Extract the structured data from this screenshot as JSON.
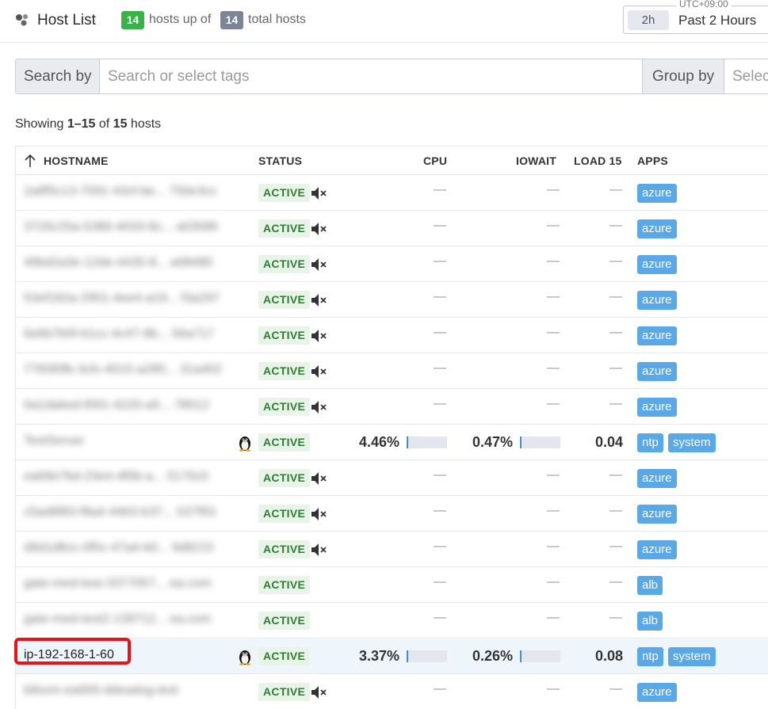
{
  "header": {
    "title": "Host List",
    "hosts_up": "14",
    "hosts_up_text": "hosts up of",
    "hosts_total": "14",
    "hosts_total_text": "total hosts",
    "timezone": "UTC+09:00",
    "time_chip": "2h",
    "time_label": "Past 2 Hours"
  },
  "search": {
    "label": "Search by",
    "placeholder": "Search or select tags",
    "group_label": "Group by",
    "group_placeholder": "Select"
  },
  "summary": {
    "prefix": "Showing",
    "range": "1–15",
    "of": "of",
    "count": "15",
    "suffix": "hosts"
  },
  "table": {
    "columns": {
      "hostname": "HOSTNAME",
      "status": "STATUS",
      "cpu": "CPU",
      "iowait": "IOWAIT",
      "load15": "LOAD 15",
      "apps": "APPS"
    },
    "rows": [
      {
        "hostname": "2a8f5c13-7591-43cf-be... 750e3cc",
        "blurred": true,
        "os": "",
        "status": "ACTIVE",
        "muted": true,
        "cpu": "—",
        "cpu_pct": null,
        "iowait": "—",
        "iowait_pct": null,
        "load15": "—",
        "apps": [
          "azure"
        ],
        "highlighted": false
      },
      {
        "hostname": "3726c25a-5380-4033-8c... a03585",
        "blurred": true,
        "os": "",
        "status": "ACTIVE",
        "muted": true,
        "cpu": "—",
        "cpu_pct": null,
        "iowait": "—",
        "iowait_pct": null,
        "load15": "—",
        "apps": [
          "azure"
        ],
        "highlighted": false
      },
      {
        "hostname": "49bd2a3e-12de-4435-8... a08480",
        "blurred": true,
        "os": "",
        "status": "ACTIVE",
        "muted": true,
        "cpu": "—",
        "cpu_pct": null,
        "iowait": "—",
        "iowait_pct": null,
        "load15": "—",
        "apps": [
          "azure"
        ],
        "highlighted": false
      },
      {
        "hostname": "53ef182a-2951-4ee4-a19... f3a297",
        "blurred": true,
        "os": "",
        "status": "ACTIVE",
        "muted": true,
        "cpu": "—",
        "cpu_pct": null,
        "iowait": "—",
        "iowait_pct": null,
        "load15": "—",
        "apps": [
          "azure"
        ],
        "highlighted": false
      },
      {
        "hostname": "6e6b7b5f-b1cc-4c47-8b... 56a717",
        "blurred": true,
        "os": "",
        "status": "ACTIVE",
        "muted": true,
        "cpu": "—",
        "cpu_pct": null,
        "iowait": "—",
        "iowait_pct": null,
        "load15": "—",
        "apps": [
          "azure"
        ],
        "highlighted": false
      },
      {
        "hostname": "7765f0fb-3cfc-4015-a285... 31a402",
        "blurred": true,
        "os": "",
        "status": "ACTIVE",
        "muted": true,
        "cpu": "—",
        "cpu_pct": null,
        "iowait": "—",
        "iowait_pct": null,
        "load15": "—",
        "apps": [
          "azure"
        ],
        "highlighted": false
      },
      {
        "hostname": "9a1dabed-f091-4220-a5... 78012",
        "blurred": true,
        "os": "",
        "status": "ACTIVE",
        "muted": true,
        "cpu": "—",
        "cpu_pct": null,
        "iowait": "—",
        "iowait_pct": null,
        "load15": "—",
        "apps": [
          "azure"
        ],
        "highlighted": false
      },
      {
        "hostname": "TestServer",
        "blurred": true,
        "os": "linux",
        "status": "ACTIVE",
        "muted": false,
        "cpu": "4.46%",
        "cpu_pct": 4.46,
        "iowait": "0.47%",
        "iowait_pct": 0.47,
        "load15": "0.04",
        "apps": [
          "ntp",
          "system"
        ],
        "highlighted": false
      },
      {
        "hostname": "ea68e7bd-23e4-4f0b-a... 5170c0",
        "blurred": true,
        "os": "",
        "status": "ACTIVE",
        "muted": true,
        "cpu": "—",
        "cpu_pct": null,
        "iowait": "—",
        "iowait_pct": null,
        "load15": "—",
        "apps": [
          "azure"
        ],
        "highlighted": false
      },
      {
        "hostname": "c5ad8f83-f8a4-4463-b37... 537f93",
        "blurred": true,
        "os": "",
        "status": "ACTIVE",
        "muted": true,
        "cpu": "—",
        "cpu_pct": null,
        "iowait": "—",
        "iowait_pct": null,
        "load15": "—",
        "apps": [
          "azure"
        ],
        "highlighted": false
      },
      {
        "hostname": "d9d1d8cc-0f5c-47a4-b0... 9d8215",
        "blurred": true,
        "os": "",
        "status": "ACTIVE",
        "muted": true,
        "cpu": "—",
        "cpu_pct": null,
        "iowait": "—",
        "iowait_pct": null,
        "load15": "—",
        "apps": [
          "azure"
        ],
        "highlighted": false
      },
      {
        "hostname": "gate-med-test-3377057... ea.com",
        "blurred": true,
        "os": "",
        "status": "ACTIVE",
        "muted": false,
        "cpu": "—",
        "cpu_pct": null,
        "iowait": "—",
        "iowait_pct": null,
        "load15": "—",
        "apps": [
          "alb"
        ],
        "highlighted": false
      },
      {
        "hostname": "gate-med-test2-139712... ea.com",
        "blurred": true,
        "os": "",
        "status": "ACTIVE",
        "muted": false,
        "cpu": "—",
        "cpu_pct": null,
        "iowait": "—",
        "iowait_pct": null,
        "load15": "—",
        "apps": [
          "alb"
        ],
        "highlighted": false
      },
      {
        "hostname": "ip-192-168-1-60",
        "blurred": false,
        "os": "linux",
        "status": "ACTIVE",
        "muted": false,
        "cpu": "3.37%",
        "cpu_pct": 3.37,
        "iowait": "0.26%",
        "iowait_pct": 0.26,
        "load15": "0.08",
        "apps": [
          "ntp",
          "system"
        ],
        "highlighted": true
      },
      {
        "hostname": "k8svm-ea005-ddeadog-test",
        "blurred": true,
        "os": "",
        "status": "ACTIVE",
        "muted": true,
        "cpu": "—",
        "cpu_pct": null,
        "iowait": "—",
        "iowait_pct": null,
        "load15": "—",
        "apps": [
          "azure"
        ],
        "highlighted": false
      }
    ]
  },
  "colors": {
    "up_badge": "#38b249",
    "total_badge": "#7c8496",
    "status_bg": "#e9f4e9",
    "status_text": "#2e7d32",
    "tag_bg": "#5aa9e6",
    "bar_fill": "#3d8fd6",
    "highlight_border": "#e8121b"
  },
  "icons": {
    "logo": "hexagon-cluster-icon",
    "sort": "arrow-up-icon",
    "os": "linux-penguin-icon",
    "muted": "speaker-muted-icon"
  }
}
